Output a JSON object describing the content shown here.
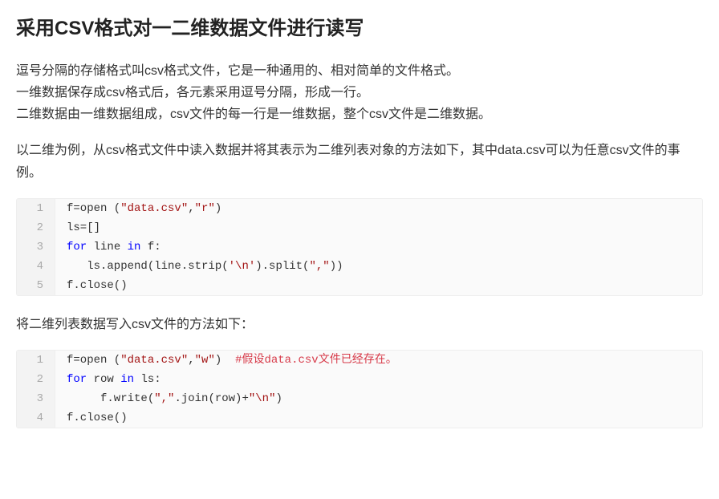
{
  "title": "采用CSV格式对一二维数据文件进行读写",
  "para1_line1": "逗号分隔的存储格式叫csv格式文件，它是一种通用的、相对简单的文件格式。",
  "para1_line2": "一维数据保存成csv格式后，各元素采用逗号分隔，形成一行。",
  "para1_line3": "二维数据由一维数据组成，csv文件的每一行是一维数据，整个csv文件是二维数据。",
  "para2": "以二维为例，从csv格式文件中读入数据并将其表示为二维列表对象的方法如下，其中data.csv可以为任意csv文件的事例。",
  "code1": {
    "l1_a": "f=open (",
    "l1_b": "\"data.csv\"",
    "l1_c": ",",
    "l1_d": "\"r\"",
    "l1_e": ")",
    "l2": "ls=[]",
    "l3_a": "for",
    "l3_b": " line ",
    "l3_c": "in",
    "l3_d": " f:",
    "l4_a": "   ls.append(line.strip(",
    "l4_b": "'\\n'",
    "l4_c": ").split(",
    "l4_d": "\",\"",
    "l4_e": "))",
    "l5": "f.close()"
  },
  "para3": "将二维列表数据写入csv文件的方法如下：",
  "code2": {
    "l1_a": "f=open (",
    "l1_b": "\"data.csv\"",
    "l1_c": ",",
    "l1_d": "\"w\"",
    "l1_e": ")  ",
    "l1_f": "#假设data.csv文件已经存在。",
    "l2_a": "for",
    "l2_b": " row ",
    "l2_c": "in",
    "l2_d": " ls:",
    "l3_a": "     f.write(",
    "l3_b": "\",\"",
    "l3_c": ".join(row)+",
    "l3_d": "\"\\n\"",
    "l3_e": ")",
    "l4": "f.close()"
  },
  "nums": {
    "n1": "1",
    "n2": "2",
    "n3": "3",
    "n4": "4",
    "n5": "5"
  }
}
